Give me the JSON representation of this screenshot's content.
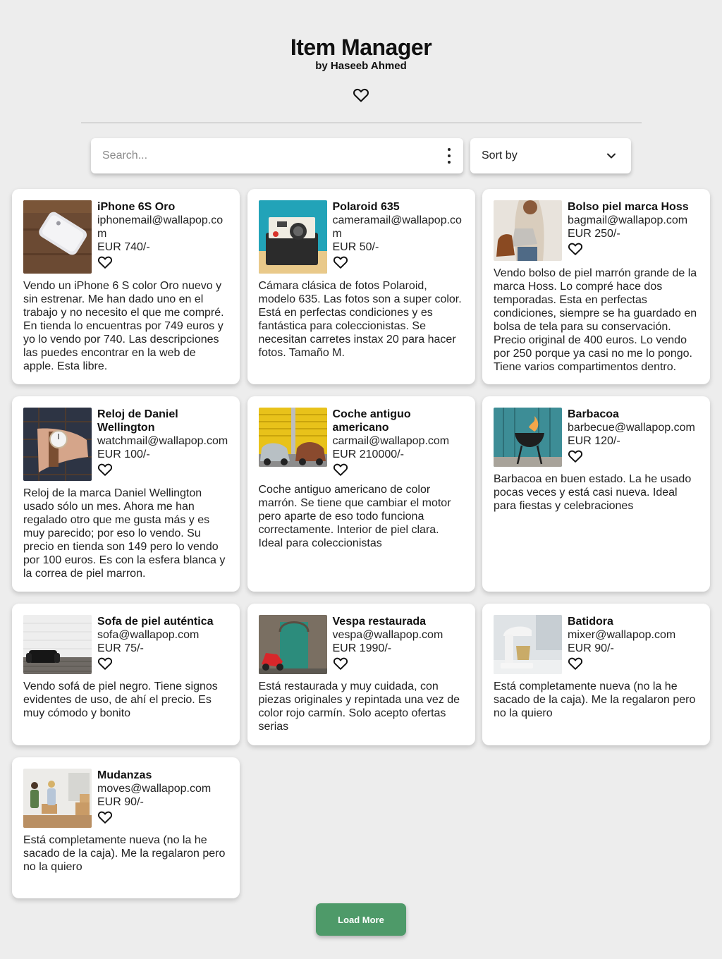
{
  "header": {
    "title": "Item Manager",
    "subtitle": "by Haseeb Ahmed",
    "favorites_icon": "heart-outline-icon"
  },
  "search": {
    "placeholder": "Search...",
    "value": "",
    "menu_icon": "kebab-menu-icon"
  },
  "sort": {
    "label": "Sort by",
    "icon": "chevron-down-icon"
  },
  "items": [
    {
      "name": "iPhone 6S Oro",
      "email": "iphonemail@wallapop.com",
      "price": "EUR 740/-",
      "description": "Vendo un iPhone 6 S color Oro nuevo y sin estrenar. Me han dado uno en el trabajo y no necesito el que me compré. En tienda lo encuentras por 749 euros y yo lo vendo por 740. Las descripciones las puedes encontrar en la web de apple. Esta libre.",
      "image": "iphone-photo"
    },
    {
      "name": "Polaroid 635",
      "email": "cameramail@wallapop.com",
      "price": "EUR 50/-",
      "description": "Cámara clásica de fotos Polaroid, modelo 635. Las fotos son a super color. Está en perfectas condiciones y es fantástica para coleccionistas. Se necesitan carretes instax 20 para hacer fotos. Tamaño M.",
      "image": "polaroid-photo"
    },
    {
      "name": "Bolso piel marca Hoss",
      "email": "bagmail@wallapop.com",
      "price": "EUR 250/-",
      "description": "Vendo bolso de piel marrón grande de la marca Hoss. Lo compré hace dos temporadas. Esta en perfectas condiciones, siempre se ha guardado en bolsa de tela para su conservación. Precio original de 400 euros. Lo vendo por 250 porque ya casi no me lo pongo. Tiene varios compartimentos dentro.",
      "image": "bag-photo"
    },
    {
      "name": "Reloj de Daniel Wellington",
      "email": "watchmail@wallapop.com",
      "price": "EUR 100/-",
      "description": "Reloj de la marca Daniel Wellington usado sólo un mes. Ahora me han regalado otro que me gusta más y es muy parecido; por eso lo vendo. Su precio en tienda son 149 pero lo vendo por 100 euros. Es con la esfera blanca y la correa de piel marron.",
      "image": "watch-photo"
    },
    {
      "name": "Coche antiguo americano",
      "email": "carmail@wallapop.com",
      "price": "EUR 210000/-",
      "description": "Coche antiguo americano de color marrón. Se tiene que cambiar el motor pero aparte de eso todo funciona correctamente. Interior de piel clara. Ideal para coleccionistas",
      "image": "car-photo"
    },
    {
      "name": "Barbacoa",
      "email": "barbecue@wallapop.com",
      "price": "EUR 120/-",
      "description": "Barbacoa en buen estado. La he usado pocas veces y está casi nueva. Ideal para fiestas y celebraciones",
      "image": "barbecue-photo"
    },
    {
      "name": "Sofa de piel auténtica",
      "email": "sofa@wallapop.com",
      "price": "EUR 75/-",
      "description": "Vendo sofá de piel negro. Tiene signos evidentes de uso, de ahí el precio. Es muy cómodo y bonito",
      "image": "sofa-photo"
    },
    {
      "name": "Vespa restaurada",
      "email": "vespa@wallapop.com",
      "price": "EUR 1990/-",
      "description": "Está restaurada y muy cuidada, con piezas originales y repintada una vez de color rojo carmín. Solo acepto ofertas serias",
      "image": "vespa-photo"
    },
    {
      "name": "Batidora",
      "email": "mixer@wallapop.com",
      "price": "EUR 90/-",
      "description": "Está completamente nueva (no la he sacado de la caja). Me la regalaron pero no la quiero",
      "image": "mixer-photo"
    },
    {
      "name": "Mudanzas",
      "email": "moves@wallapop.com",
      "price": "EUR 90/-",
      "description": "Está completamente nueva (no la he sacado de la caja). Me la regalaron pero no la quiero",
      "image": "moving-photo"
    }
  ],
  "load_more": {
    "label": "Load More"
  },
  "colors": {
    "background": "#ededed",
    "card": "#ffffff",
    "accent_green": "#4e9a69"
  }
}
